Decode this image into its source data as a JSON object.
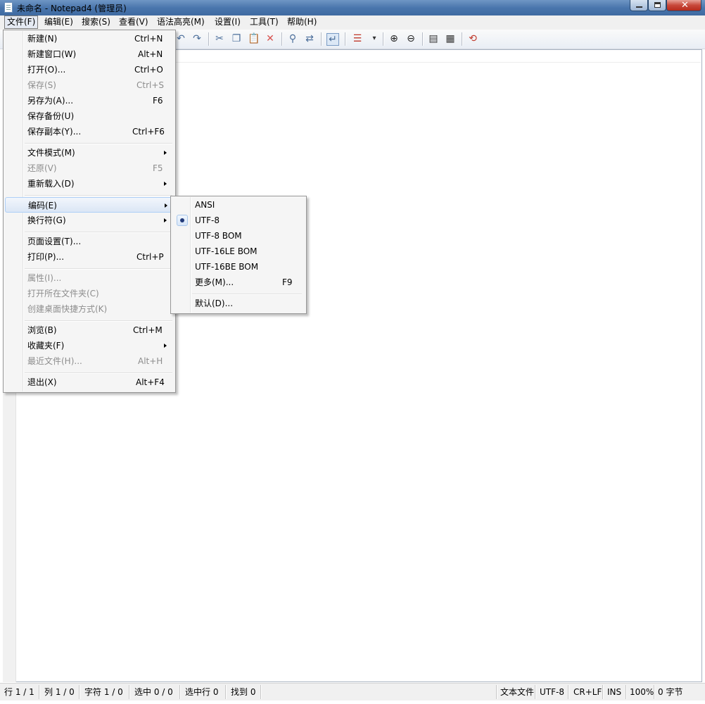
{
  "window": {
    "title": "未命名 - Notepad4 (管理员)",
    "close_glyph": "✕"
  },
  "menubar": {
    "items": [
      "文件(F)",
      "编辑(E)",
      "搜索(S)",
      "查看(V)",
      "语法高亮(M)",
      "设置(I)",
      "工具(T)",
      "帮助(H)"
    ]
  },
  "toolbar": {
    "icons": [
      "undo-icon",
      "redo-icon",
      "cut-icon",
      "copy-icon",
      "paste-icon",
      "delete-icon",
      "find-icon",
      "replace-icon",
      "word-wrap-icon",
      "scheme-icon",
      "dropdown-icon",
      "zoom-in-icon",
      "zoom-out-icon",
      "view-icon",
      "settings-icon",
      "exit-icon"
    ]
  },
  "file_menu": {
    "items": [
      {
        "label": "新建(N)",
        "shortcut": "Ctrl+N"
      },
      {
        "label": "新建窗口(W)",
        "shortcut": "Alt+N"
      },
      {
        "label": "打开(O)...",
        "shortcut": "Ctrl+O"
      },
      {
        "label": "保存(S)",
        "shortcut": "Ctrl+S"
      },
      {
        "label": "另存为(A)...",
        "shortcut": "F6"
      },
      {
        "label": "保存备份(U)",
        "shortcut": ""
      },
      {
        "label": "保存副本(Y)...",
        "shortcut": "Ctrl+F6"
      },
      {
        "label": "文件模式(M)",
        "shortcut": ""
      },
      {
        "label": "还原(V)",
        "shortcut": "F5"
      },
      {
        "label": "重新载入(D)",
        "shortcut": ""
      },
      {
        "label": "编码(E)",
        "shortcut": ""
      },
      {
        "label": "换行符(G)",
        "shortcut": ""
      },
      {
        "label": "页面设置(T)...",
        "shortcut": ""
      },
      {
        "label": "打印(P)...",
        "shortcut": "Ctrl+P"
      },
      {
        "label": "属性(I)...",
        "shortcut": ""
      },
      {
        "label": "打开所在文件夹(C)",
        "shortcut": ""
      },
      {
        "label": "创建桌面快捷方式(K)",
        "shortcut": ""
      },
      {
        "label": "浏览(B)",
        "shortcut": "Ctrl+M"
      },
      {
        "label": "收藏夹(F)",
        "shortcut": ""
      },
      {
        "label": "最近文件(H)...",
        "shortcut": "Alt+H"
      },
      {
        "label": "退出(X)",
        "shortcut": "Alt+F4"
      }
    ]
  },
  "encoding_menu": {
    "items": [
      {
        "label": "ANSI",
        "shortcut": ""
      },
      {
        "label": "UTF-8",
        "shortcut": ""
      },
      {
        "label": "UTF-8 BOM",
        "shortcut": ""
      },
      {
        "label": "UTF-16LE BOM",
        "shortcut": ""
      },
      {
        "label": "UTF-16BE BOM",
        "shortcut": ""
      },
      {
        "label": "更多(M)...",
        "shortcut": "F9"
      },
      {
        "label": "默认(D)...",
        "shortcut": ""
      }
    ],
    "selected": "UTF-8"
  },
  "statusbar": {
    "left": [
      "行 1 / 1",
      "列 1 / 0",
      "字符 1 / 0",
      "选中 0 / 0",
      "选中行 0",
      "找到 0"
    ],
    "right": [
      "文本文件",
      "UTF-8",
      "CR+LF",
      "INS",
      "100%",
      "0 字节"
    ]
  }
}
